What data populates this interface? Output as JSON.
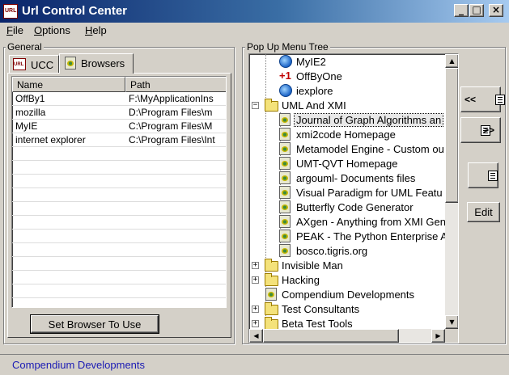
{
  "window": {
    "title": "Url Control Center",
    "app_icon_text": "URL"
  },
  "caption_buttons": {
    "minimize": "_",
    "maximize": "□",
    "close": "×"
  },
  "menu": [
    {
      "label": "File",
      "underline": "F",
      "rest": "ile"
    },
    {
      "label": "Options",
      "underline": "O",
      "rest": "ptions"
    },
    {
      "label": "Help",
      "underline": "H",
      "rest": "elp"
    }
  ],
  "general": {
    "group_label": "General",
    "tabs": [
      {
        "label": "UCC"
      },
      {
        "label": "Browsers"
      }
    ],
    "list": {
      "columns": [
        "Name",
        "Path"
      ],
      "rows": [
        {
          "name": "OffBy1",
          "path": "F:\\MyApplicationIns"
        },
        {
          "name": "mozilla",
          "path": "D:\\Program Files\\m"
        },
        {
          "name": "MyIE",
          "path": "C:\\Program Files\\M"
        },
        {
          "name": "internet explorer",
          "path": "C:\\Program Files\\Int"
        }
      ]
    },
    "set_browser_button": "Set Browser To Use"
  },
  "tree": {
    "group_label": "Pop Up Menu Tree",
    "items": [
      {
        "label": "MyIE2",
        "icon": "globe-icon"
      },
      {
        "label": "OffByOne",
        "icon": "offbyone-icon"
      },
      {
        "label": "iexplore",
        "icon": "ie-icon"
      },
      {
        "label": "UML And XMI",
        "icon": "folder-icon",
        "expander": "−"
      },
      {
        "label": "Journal of Graph Algorithms an",
        "icon": "page-icon",
        "selected": true
      },
      {
        "label": "xmi2code Homepage",
        "icon": "page-icon"
      },
      {
        "label": "Metamodel Engine - Custom ou",
        "icon": "page-icon"
      },
      {
        "label": "UMT-QVT Homepage",
        "icon": "page-icon"
      },
      {
        "label": "argouml- Documents  files",
        "icon": "page-icon"
      },
      {
        "label": "Visual Paradigm for UML Featu",
        "icon": "page-icon"
      },
      {
        "label": "Butterfly Code Generator",
        "icon": "page-icon"
      },
      {
        "label": "AXgen - Anything from XMI Gen",
        "icon": "page-icon"
      },
      {
        "label": "PEAK - The Python Enterprise A",
        "icon": "page-icon"
      },
      {
        "label": "bosco.tigris.org",
        "icon": "page-icon"
      },
      {
        "label": "Invisible Man",
        "icon": "folder-icon",
        "expander": "+"
      },
      {
        "label": "Hacking",
        "icon": "folder-icon",
        "expander": "+"
      },
      {
        "label": "Compendium Developments",
        "icon": "page-icon"
      },
      {
        "label": "Test Consultants",
        "icon": "folder-icon",
        "expander": "+"
      },
      {
        "label": "Beta Test Tools",
        "icon": "folder-icon",
        "expander": "+"
      }
    ]
  },
  "side_buttons": {
    "move_left": "<<",
    "move_right": ">>",
    "edit": "Edit"
  },
  "status": {
    "text": "Compendium Developments"
  },
  "colors": {
    "titlebar_start": "#0a246a",
    "titlebar_end": "#a6caf0",
    "face": "#d4d0c8",
    "status_text": "#1a1ab4"
  }
}
